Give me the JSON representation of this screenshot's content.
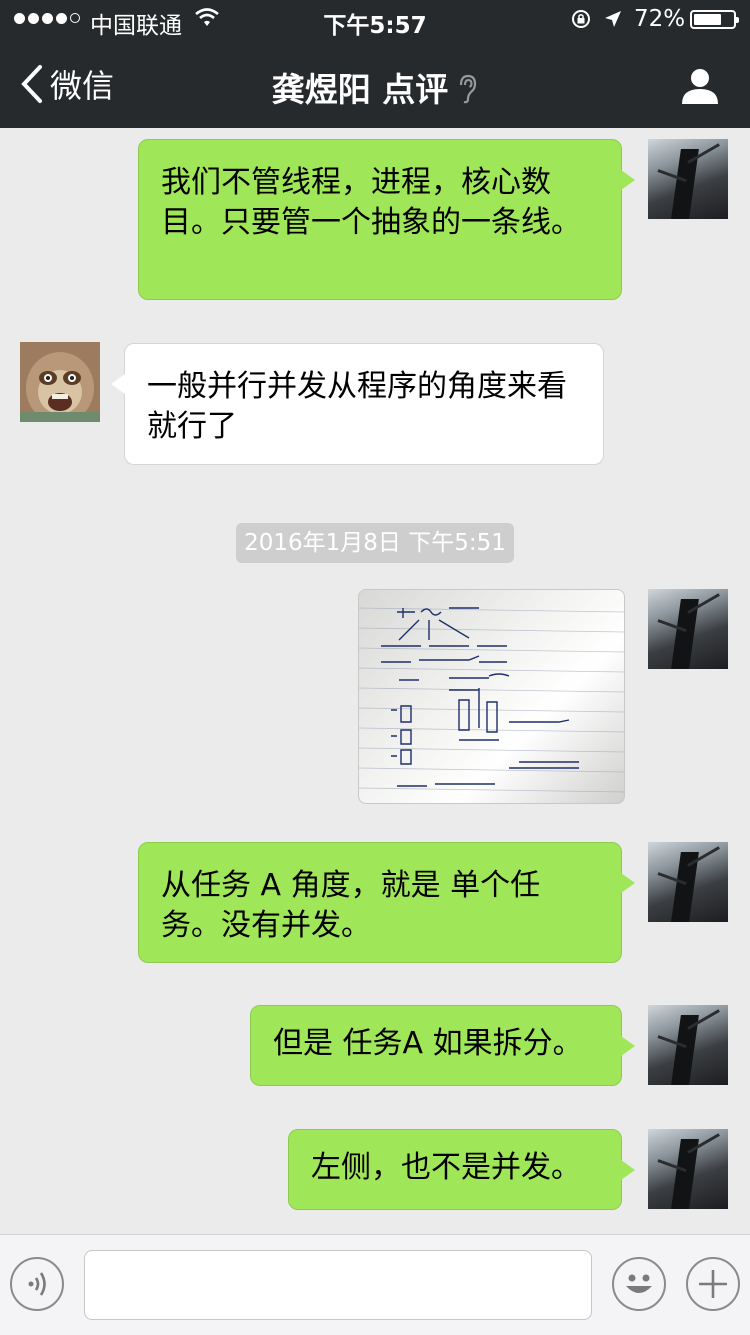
{
  "status_bar": {
    "carrier": "中国联通",
    "time": "下午5:57",
    "battery_percent": "72%",
    "battery_level": 0.72,
    "icons": [
      "signal-dots",
      "wifi-icon",
      "rotation-lock-icon",
      "location-arrow-icon",
      "battery-icon"
    ]
  },
  "nav": {
    "back_label": "微信",
    "title": "龚煜阳 点评",
    "icons": [
      "chevron-left-icon",
      "ear-icon",
      "profile-icon"
    ]
  },
  "messages": [
    {
      "side": "right",
      "text": "我们不管线程，进程，核心数目。只要管一个抽象的一条线。"
    },
    {
      "side": "left",
      "text": "一般并行并发从程序的角度来看就行了"
    },
    {
      "timestamp": "2016年1月8日 下午5:51"
    },
    {
      "side": "right",
      "type": "image",
      "image_desc": "handwritten-notes-photo"
    },
    {
      "side": "right",
      "text": "从任务 A 角度，就是 单个任务。没有并发。"
    },
    {
      "side": "right",
      "text": "但是 任务A 如果拆分。"
    },
    {
      "side": "right",
      "text": "左侧，也不是并发。"
    }
  ],
  "input_bar": {
    "icons": [
      "voice-icon",
      "emoji-icon",
      "plus-icon"
    ],
    "input_value": ""
  }
}
